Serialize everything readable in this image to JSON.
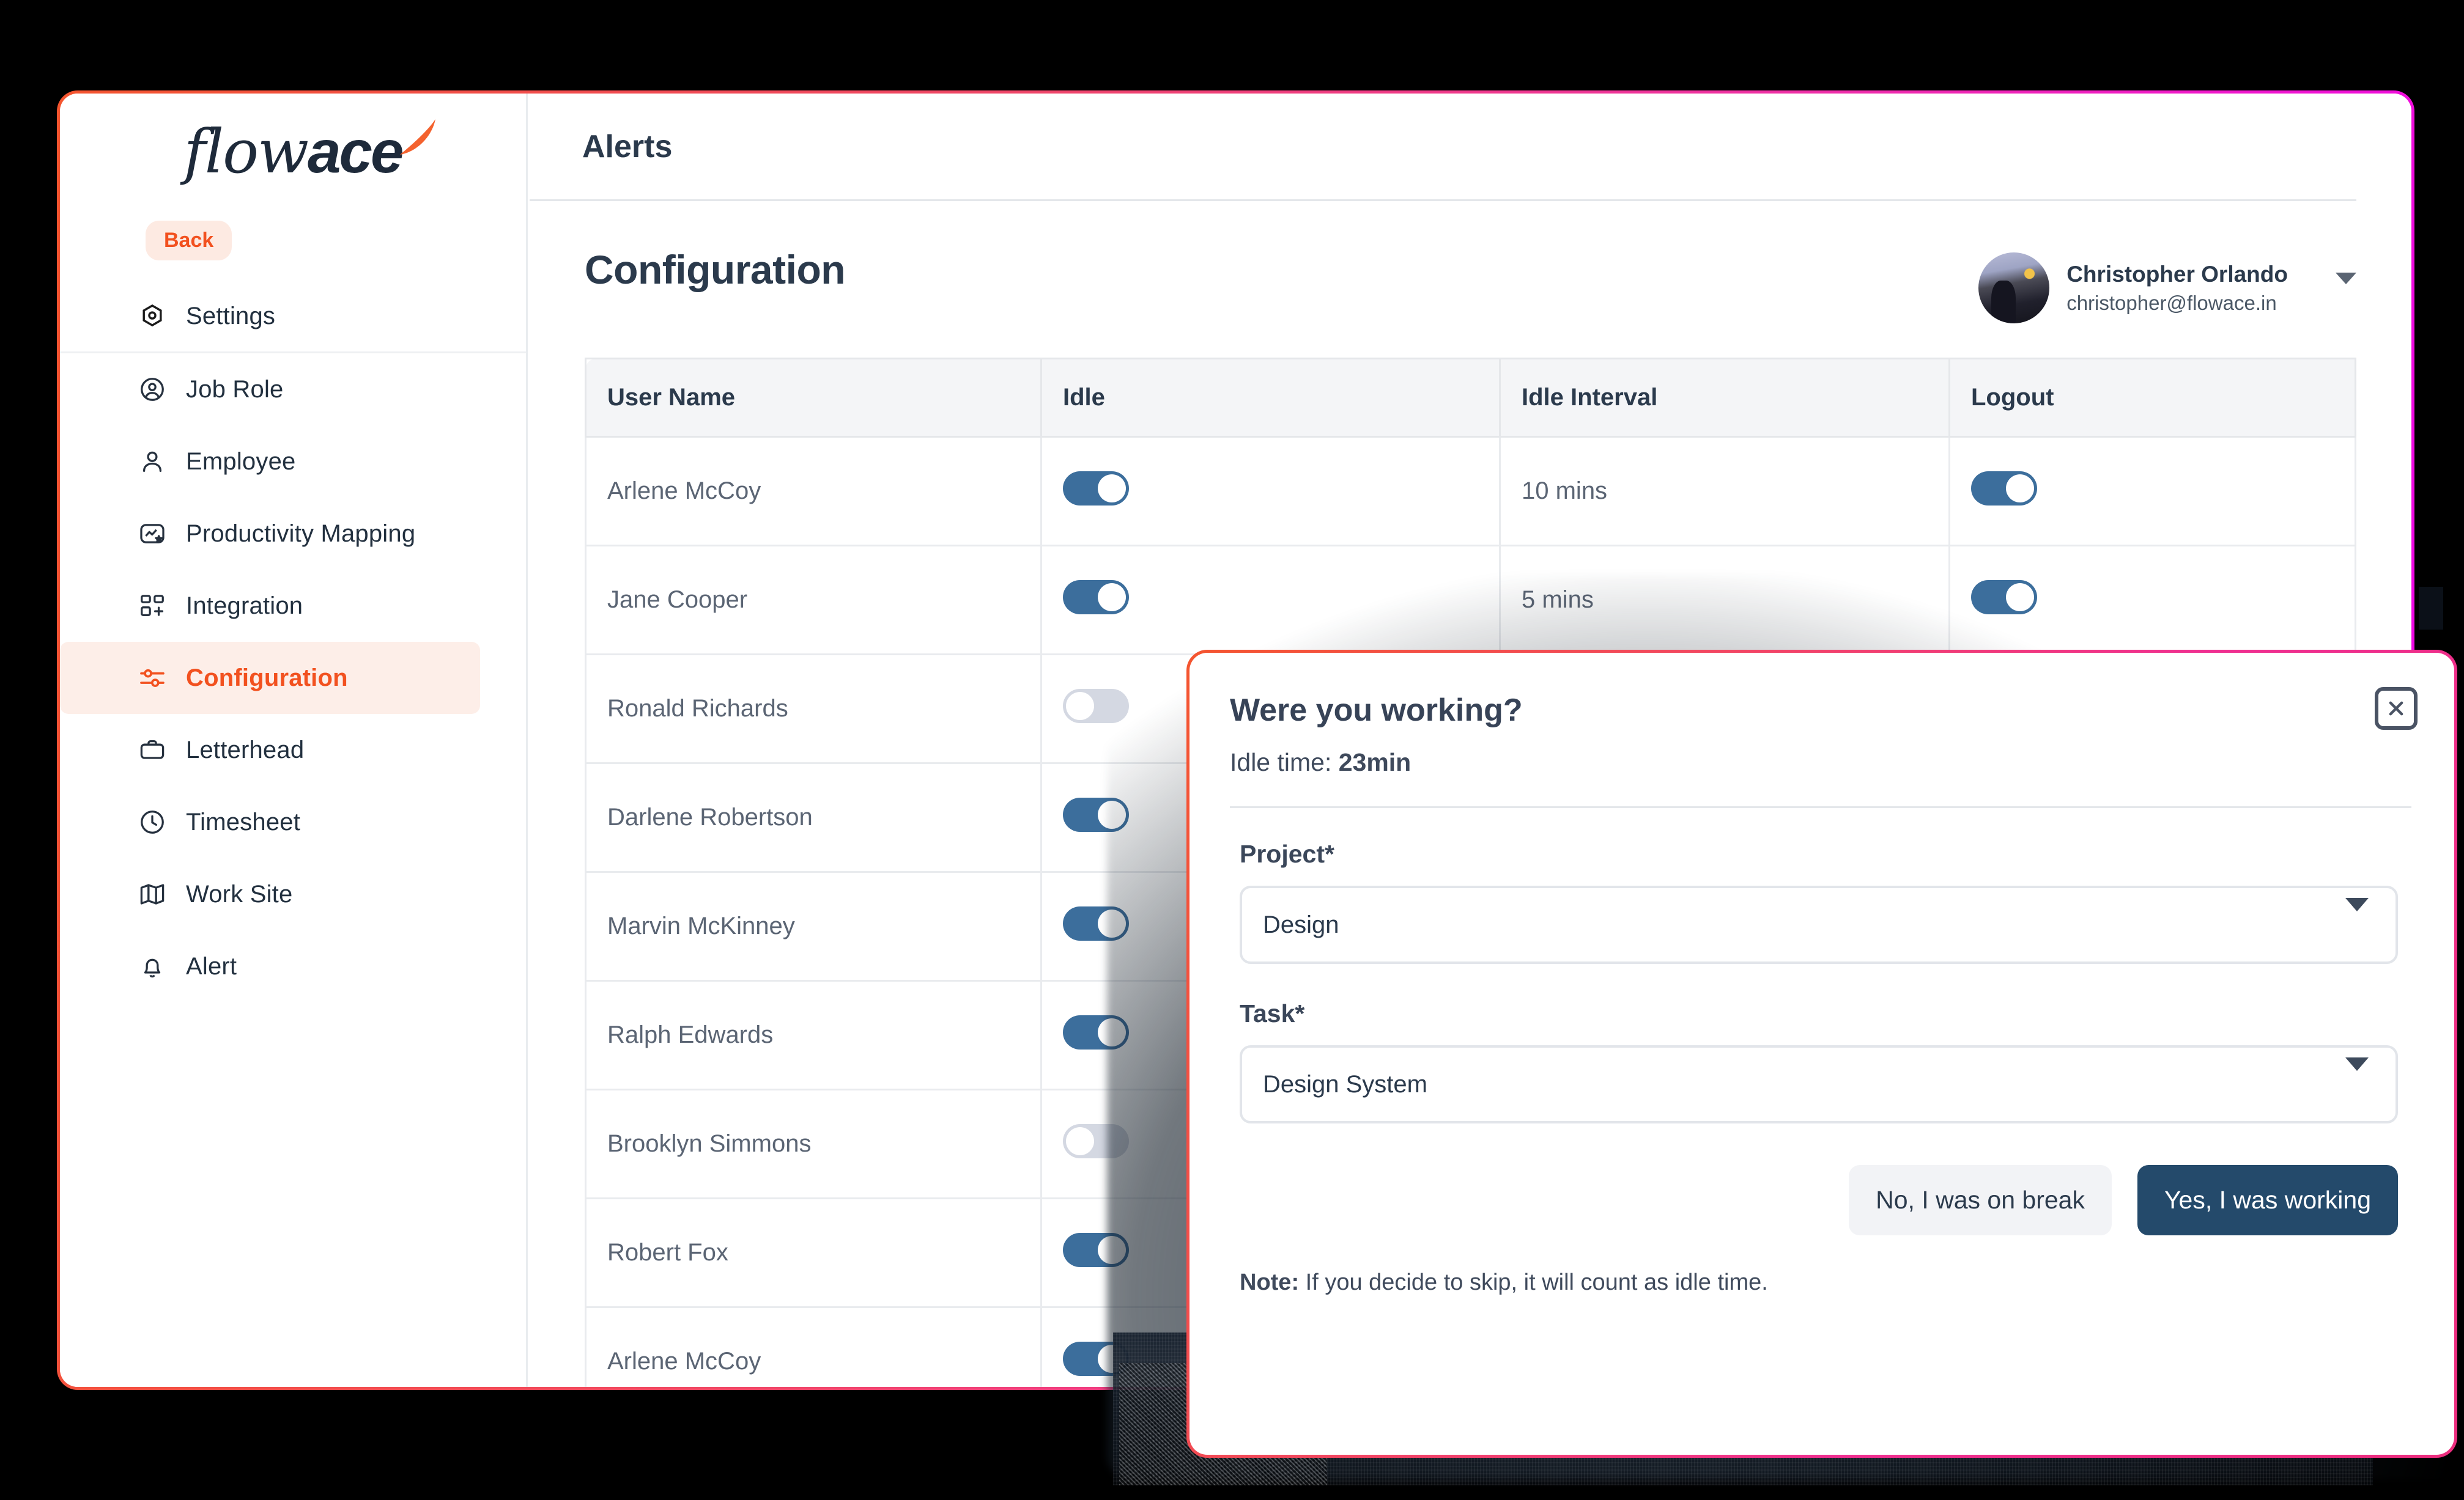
{
  "brand": {
    "logo_flow": "flow",
    "logo_ace": "ace",
    "accent_orange": "#f2511f",
    "accent_magenta": "#ef2fa8",
    "toggle_on_color": "#3c6e9c",
    "toggle_off_color": "#d4d8e2",
    "primary_button_color": "#244a6b"
  },
  "sidebar": {
    "back_label": "Back",
    "items": [
      {
        "label": "Settings",
        "icon": "settings-hexagon-icon",
        "active": false
      },
      {
        "label": "Job Role",
        "icon": "user-circle-icon",
        "active": false
      },
      {
        "label": "Employee",
        "icon": "person-icon",
        "active": false
      },
      {
        "label": "Productivity Mapping",
        "icon": "chart-star-icon",
        "active": false
      },
      {
        "label": "Integration",
        "icon": "grid-plus-icon",
        "active": false
      },
      {
        "label": "Configuration",
        "icon": "sliders-icon",
        "active": true
      },
      {
        "label": "Letterhead",
        "icon": "briefcase-icon",
        "active": false
      },
      {
        "label": "Timesheet",
        "icon": "clock-icon",
        "active": false
      },
      {
        "label": "Work Site",
        "icon": "map-icon",
        "active": false
      },
      {
        "label": "Alert",
        "icon": "bell-icon",
        "active": false
      }
    ]
  },
  "topbar": {
    "title": "Alerts"
  },
  "page": {
    "title": "Configuration"
  },
  "profile": {
    "name": "Christopher Orlando",
    "email": "christopher@flowace.in",
    "caret_icon": "chevron-down-icon",
    "avatar_icon": "avatar"
  },
  "table": {
    "columns": [
      "User Name",
      "Idle",
      "Idle Interval",
      "Logout"
    ],
    "rows": [
      {
        "user": "Arlene McCoy",
        "idle": true,
        "interval": "10 mins",
        "logout": true
      },
      {
        "user": "Jane Cooper",
        "idle": true,
        "interval": "5 mins",
        "logout": true
      },
      {
        "user": "Ronald Richards",
        "idle": false,
        "interval": "",
        "logout": false
      },
      {
        "user": "Darlene Robertson",
        "idle": true,
        "interval": "",
        "logout": false
      },
      {
        "user": "Marvin McKinney",
        "idle": true,
        "interval": "",
        "logout": false
      },
      {
        "user": "Ralph Edwards",
        "idle": true,
        "interval": "",
        "logout": false
      },
      {
        "user": "Brooklyn Simmons",
        "idle": false,
        "interval": "",
        "logout": false
      },
      {
        "user": "Robert Fox",
        "idle": true,
        "interval": "",
        "logout": false
      },
      {
        "user": "Arlene McCoy",
        "idle": true,
        "interval": "",
        "logout": false
      }
    ]
  },
  "modal": {
    "title": "Were you working?",
    "subtitle_prefix": "Idle time: ",
    "subtitle_value": "23min",
    "close_icon": "close-icon",
    "project_label": "Project*",
    "project_value": "Design",
    "task_label": "Task*",
    "task_value": "Design System",
    "dropdown_icon": "chevron-down-icon",
    "btn_break": "No, I was on break",
    "btn_working": "Yes, I was working",
    "note_label": "Note:",
    "note_text": " If you decide to skip, it will count as idle time."
  }
}
